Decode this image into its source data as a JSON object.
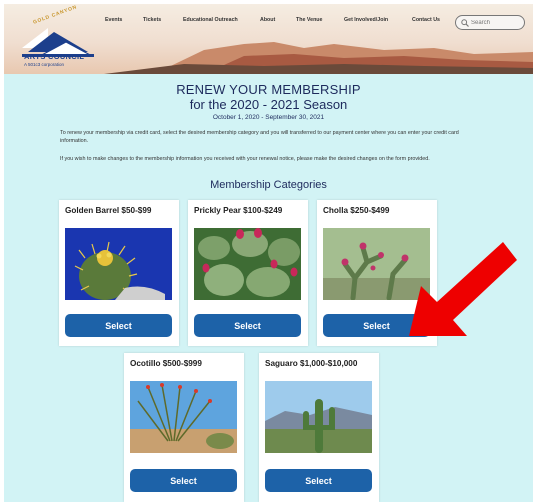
{
  "logo": {
    "arc_text": "GOLD CANYON",
    "name": "ARTS COUNCIL",
    "subtitle": "A 501c3 corporation"
  },
  "nav": {
    "items": [
      "Events",
      "Tickets",
      "Educational Outreach",
      "About",
      "The Venue",
      "Get Involved/Join",
      "Contact Us"
    ]
  },
  "search": {
    "placeholder": "Search",
    "icon": "search-icon"
  },
  "page": {
    "title_line1": "RENEW YOUR MEMBERSHIP",
    "title_line2": "for the 2020 - 2021 Season",
    "dates": "October 1, 2020 - September 30, 2021",
    "para1": "To renew your membership via credit card, select the desired membership category and you will transferred to our payment center where you can enter your credit card information.",
    "para2": "If you wish to make changes to the membership information you received with your renewal notice, please make the desired changes on the form provided.",
    "categories_heading": "Membership Categories"
  },
  "cards": [
    {
      "title": "Golden Barrel $50-$99",
      "button": "Select"
    },
    {
      "title": "Prickly Pear $100-$249",
      "button": "Select"
    },
    {
      "title": "Cholla $250-$499",
      "button": "Select"
    },
    {
      "title": "Ocotillo $500-$999",
      "button": "Select"
    },
    {
      "title": "Saguaro $1,000-$10,000",
      "button": "Select"
    }
  ],
  "colors": {
    "background": "#d2f3f5",
    "title": "#1d2a5c",
    "button": "#1d62a8",
    "arrow": "#ee0000",
    "logo_blue": "#1c3f8c"
  }
}
